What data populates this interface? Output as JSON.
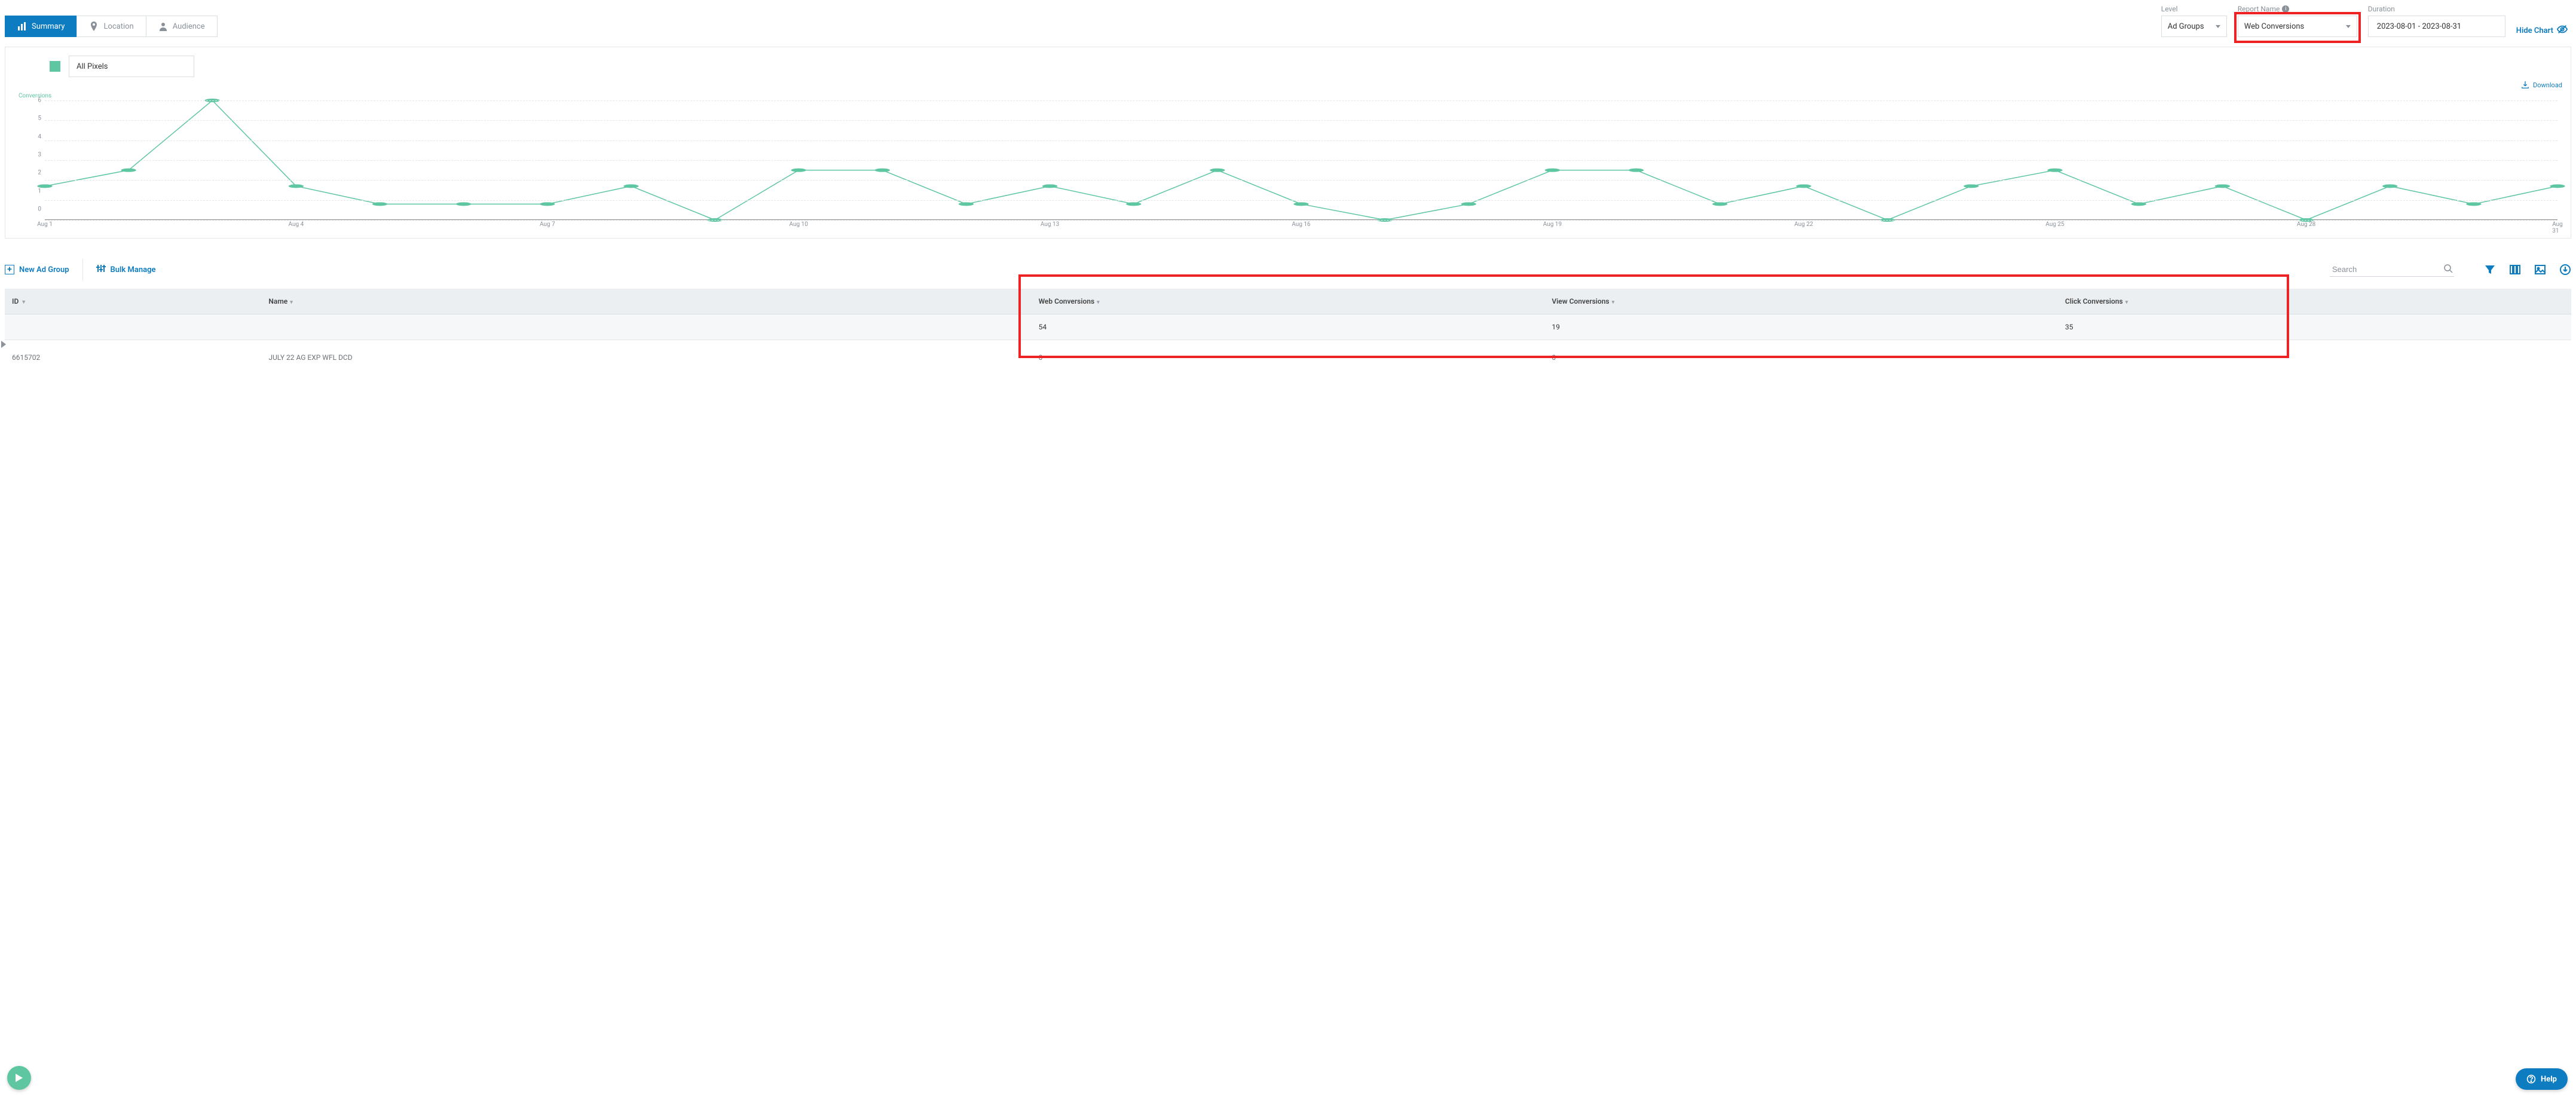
{
  "tabs": {
    "summary": "Summary",
    "location": "Location",
    "audience": "Audience"
  },
  "fields": {
    "level_label": "Level",
    "level_value": "Ad Groups",
    "report_label": "Report Name",
    "report_value": "Web Conversions",
    "duration_label": "Duration",
    "duration_value": "2023-08-01 - 2023-08-31"
  },
  "hide_chart": "Hide Chart",
  "pixel_select": "All Pixels",
  "download_label": "Download",
  "chart_data": {
    "type": "line",
    "title": "",
    "ylabel": "Conversions",
    "xlabel": "",
    "ylim": [
      0,
      6
    ],
    "yticks": [
      0,
      1,
      2,
      3,
      4,
      5,
      6
    ],
    "categories": [
      "Aug 1",
      "Aug 2",
      "Aug 3",
      "Aug 4",
      "Aug 5",
      "Aug 6",
      "Aug 7",
      "Aug 8",
      "Aug 9",
      "Aug 10",
      "Aug 11",
      "Aug 12",
      "Aug 13",
      "Aug 14",
      "Aug 15",
      "Aug 16",
      "Aug 17",
      "Aug 18",
      "Aug 19",
      "Aug 20",
      "Aug 21",
      "Aug 22",
      "Aug 23",
      "Aug 24",
      "Aug 25",
      "Aug 26",
      "Aug 27",
      "Aug 28",
      "Aug 29",
      "Aug 30",
      "Aug 31"
    ],
    "values": [
      1.7,
      2.5,
      6.0,
      1.7,
      0.8,
      0.8,
      0.8,
      1.7,
      0,
      2.5,
      2.5,
      0.8,
      1.7,
      0.8,
      2.5,
      0.8,
      0,
      0.8,
      2.5,
      2.5,
      0.8,
      1.7,
      0,
      1.7,
      2.5,
      0.8,
      1.7,
      0,
      1.7,
      0.8,
      1.7
    ],
    "x_tick_labels": [
      "Aug 1",
      "Aug 4",
      "Aug 7",
      "Aug 10",
      "Aug 13",
      "Aug 16",
      "Aug 19",
      "Aug 22",
      "Aug 25",
      "Aug 28",
      "Aug 31"
    ],
    "x_tick_positions": [
      0,
      3,
      6,
      9,
      12,
      15,
      18,
      21,
      24,
      27,
      30
    ]
  },
  "toolbar": {
    "new_adgroup": "New Ad Group",
    "bulk": "Bulk Manage",
    "search_placeholder": "Search"
  },
  "table": {
    "cols": {
      "id": "ID",
      "name": "Name",
      "web": "Web Conversions",
      "view": "View Conversions",
      "click": "Click Conversions"
    },
    "totals": {
      "web": "54",
      "view": "19",
      "click": "35"
    },
    "row_cut": {
      "id_fragment": "6615702",
      "name_fragment": "JULY 22 AG EXP WFL DCD",
      "web": "0",
      "view": "0"
    }
  },
  "help": "Help"
}
